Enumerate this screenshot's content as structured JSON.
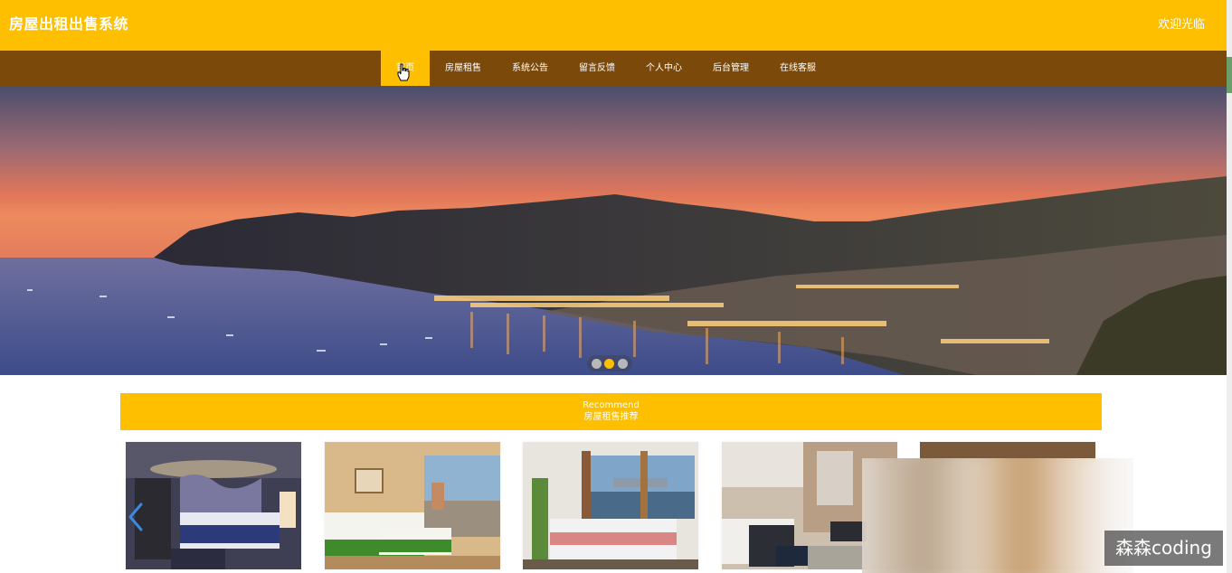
{
  "header": {
    "title": "房屋出租出售系统",
    "welcome": "欢迎光临"
  },
  "nav": {
    "items": [
      {
        "label": "首页"
      },
      {
        "label": "房屋租售"
      },
      {
        "label": "系统公告"
      },
      {
        "label": "留言反馈"
      },
      {
        "label": "个人中心"
      },
      {
        "label": "后台管理"
      },
      {
        "label": "在线客服"
      }
    ]
  },
  "banner": {
    "slide_count": 3,
    "active_slide": 2
  },
  "recommend": {
    "title_en": "Recommend",
    "title_cn": "房屋租售推荐"
  },
  "listings": {
    "visible_cards": 5
  },
  "watermark": "森森coding",
  "colors": {
    "brand_yellow": "#fdbf00",
    "nav_brown": "#7b4a0a"
  },
  "icons": {
    "cursor": "hand-pointer-icon",
    "carousel_prev": "chevron-left-icon"
  }
}
